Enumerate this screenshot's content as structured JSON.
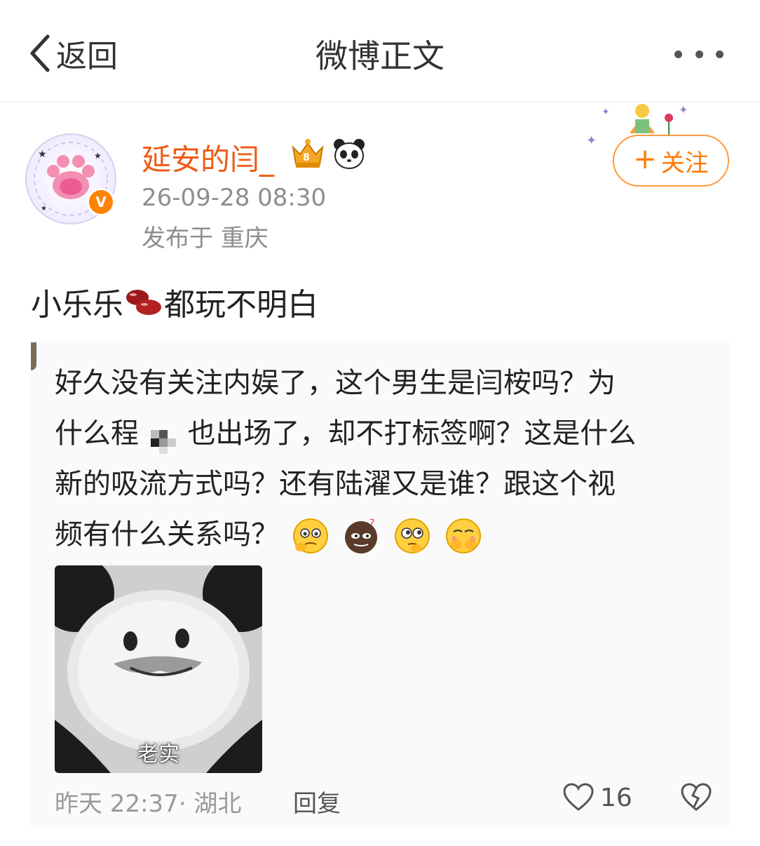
{
  "nav": {
    "back_label": "返回",
    "title": "微博正文"
  },
  "author": {
    "name": "延安的闫_",
    "time": "26-09-28 08:30",
    "location": "发布于 重庆",
    "verified_mark": "V"
  },
  "follow": {
    "plus": "+",
    "label": "关注"
  },
  "post": {
    "text_before": "小乐乐",
    "text_after": "都玩不明白"
  },
  "comment": {
    "line1": "好久没有关注内娱了，这个男生是闫桉吗？为",
    "line2_a": "什么程",
    "line2_b": "也出场了，却不打标签啊？这是什么",
    "line3": "新的吸流方式吗？还有陆濯又是谁？跟这个视",
    "line4": "频有什么关系吗？",
    "image_caption": "老实",
    "meta": "昨天 22:37· 湖北",
    "reply_label": "回复",
    "like_count": "16"
  },
  "colors": {
    "accent": "#ff8200",
    "username": "#f05a14",
    "meta": "#8e8e8e"
  }
}
